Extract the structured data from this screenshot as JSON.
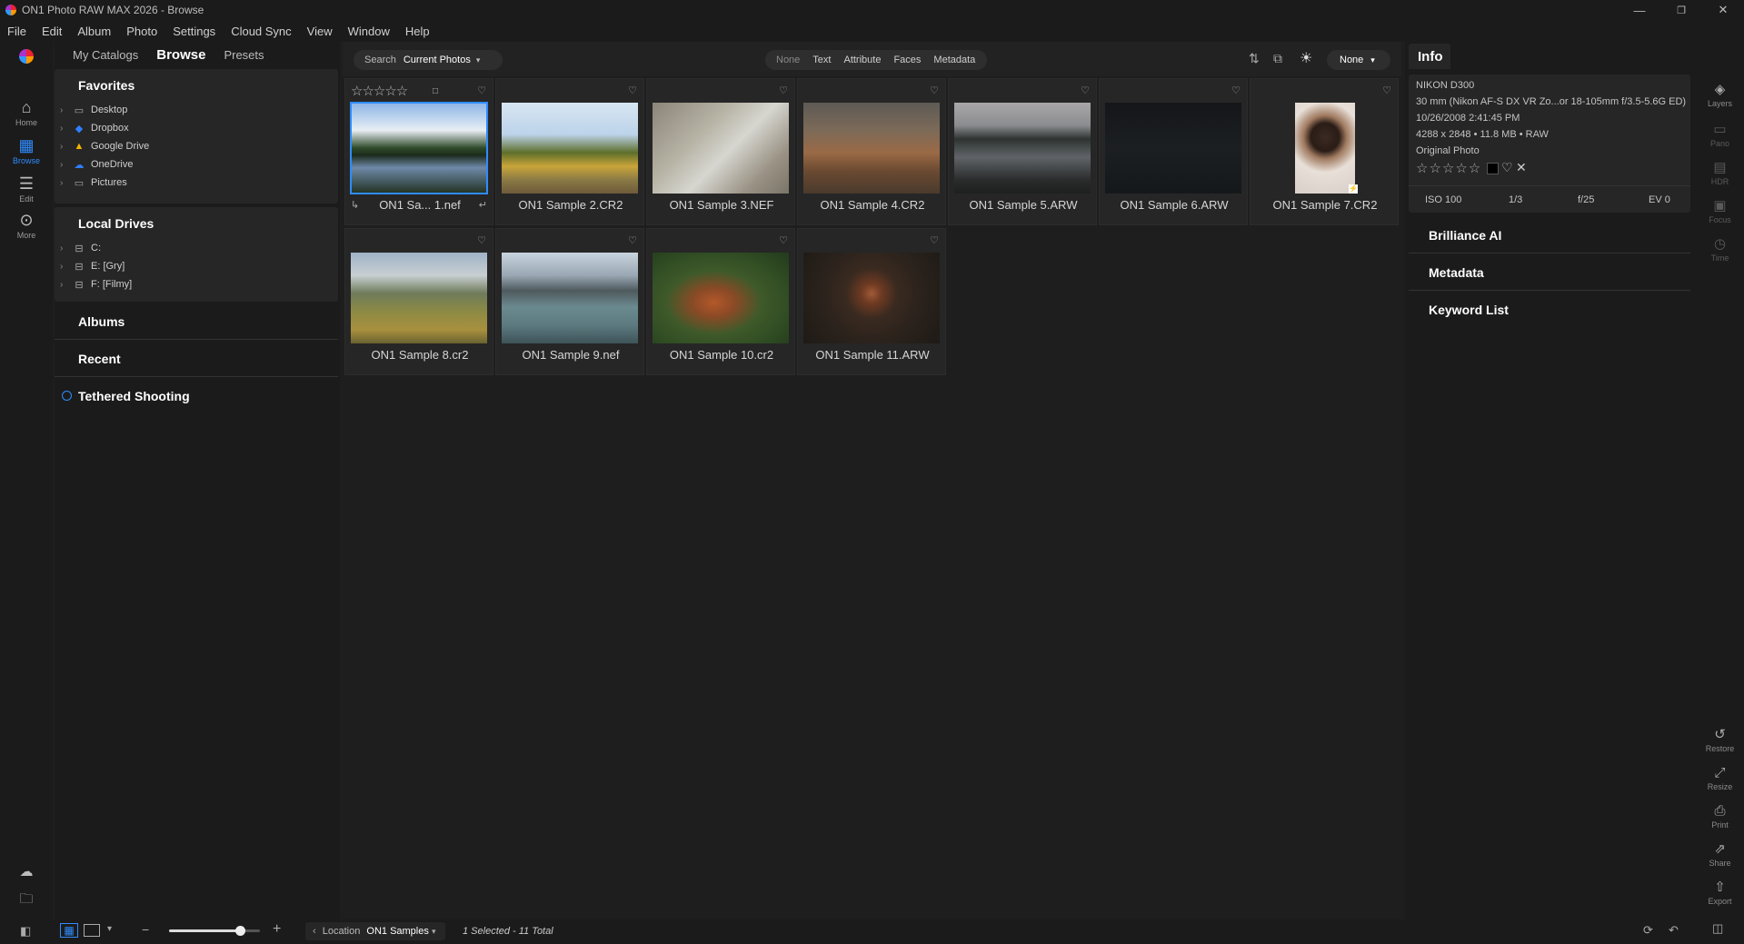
{
  "window": {
    "title": "ON1 Photo RAW MAX 2026 - Browse",
    "minimize": "—",
    "restore": "❐",
    "close": "✕"
  },
  "menu": [
    "File",
    "Edit",
    "Album",
    "Photo",
    "Settings",
    "Cloud Sync",
    "View",
    "Window",
    "Help"
  ],
  "left_rail": [
    {
      "label": "Home",
      "icon": "home-icon"
    },
    {
      "label": "Browse",
      "icon": "grid-icon"
    },
    {
      "label": "Edit",
      "icon": "sliders-icon"
    },
    {
      "label": "More",
      "icon": "more-icon"
    }
  ],
  "left_tabs": [
    "My Catalogs",
    "Browse",
    "Presets"
  ],
  "favorites": {
    "title": "Favorites",
    "items": [
      "Desktop",
      "Dropbox",
      "Google Drive",
      "OneDrive",
      "Pictures"
    ]
  },
  "local_drives": {
    "title": "Local Drives",
    "items": [
      "C:",
      "E: [Gry]",
      "F: [Filmy]"
    ]
  },
  "albums": "Albums",
  "recent": "Recent",
  "tethered": "Tethered Shooting",
  "search": {
    "label": "Search",
    "scope": "Current Photos"
  },
  "filters": [
    "None",
    "Text",
    "Attribute",
    "Faces",
    "Metadata"
  ],
  "sort_dropdown": "None",
  "photos": [
    {
      "name": "ON1 Sa... 1.nef",
      "selected": true
    },
    {
      "name": "ON1 Sample 2.CR2"
    },
    {
      "name": "ON1 Sample 3.NEF"
    },
    {
      "name": "ON1 Sample 4.CR2"
    },
    {
      "name": "ON1 Sample 5.ARW"
    },
    {
      "name": "ON1 Sample 6.ARW"
    },
    {
      "name": "ON1 Sample 7.CR2"
    },
    {
      "name": "ON1 Sample 8.cr2"
    },
    {
      "name": "ON1 Sample 9.nef"
    },
    {
      "name": "ON1 Sample 10.cr2"
    },
    {
      "name": "ON1 Sample 11.ARW"
    }
  ],
  "info": {
    "title": "Info",
    "camera": "NIKON D300",
    "lens": "30 mm (Nikon AF-S DX VR Zo...or 18-105mm f/3.5-5.6G ED)",
    "date": "10/26/2008 2:41:45 PM",
    "size": "4288 x 2848 • 11.8 MB • RAW",
    "type": "Original Photo",
    "iso": "ISO 100",
    "shutter": "1/3",
    "aperture": "f/25",
    "ev": "EV 0"
  },
  "right_sections": [
    "Brilliance AI",
    "Metadata",
    "Keyword List"
  ],
  "right_tools_top": [
    {
      "label": "Layers",
      "icon": "layers-icon"
    },
    {
      "label": "Pano",
      "icon": "pano-icon"
    },
    {
      "label": "HDR",
      "icon": "hdr-icon"
    },
    {
      "label": "Focus",
      "icon": "focus-icon"
    },
    {
      "label": "Time",
      "icon": "time-icon"
    }
  ],
  "right_tools_bottom": [
    {
      "label": "Restore",
      "icon": "restore-icon"
    },
    {
      "label": "Resize",
      "icon": "resize-icon"
    },
    {
      "label": "Print",
      "icon": "print-icon"
    },
    {
      "label": "Share",
      "icon": "share-icon"
    },
    {
      "label": "Export",
      "icon": "export-icon"
    }
  ],
  "bottom": {
    "location_label": "Location",
    "location_value": "ON1 Samples",
    "status": "1 Selected - 11 Total",
    "zoom_fraction": 0.78
  },
  "colors": {
    "accent": "#2f8cff",
    "panel": "#262626",
    "bg": "#1e1e1e"
  }
}
